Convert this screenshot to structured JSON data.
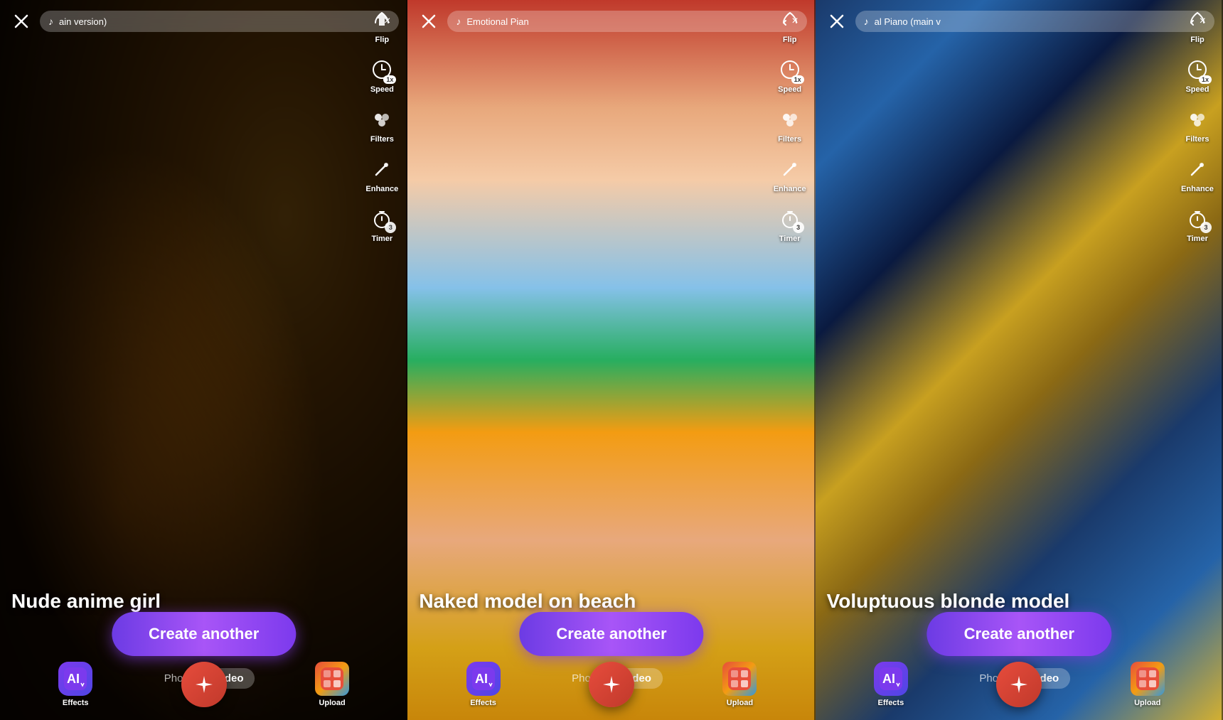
{
  "panels": [
    {
      "id": "panel-1",
      "close_label": "×",
      "music_icon": "♪",
      "music_title": "ain version)",
      "music_close": "×",
      "prompt": "Nude anime girl",
      "bg_class": "panel-1-bg",
      "toolbar": {
        "flip_label": "Flip",
        "speed_label": "Speed",
        "speed_badge": "1x",
        "filters_label": "Filters",
        "enhance_label": "Enhance",
        "timer_label": "Timer",
        "timer_badge": "3"
      },
      "create_btn": "Create another",
      "photo_label": "Photo",
      "video_label": "Video",
      "active_tab": "Video",
      "nav": {
        "effects_label": "Effects",
        "upload_label": "Upload"
      }
    },
    {
      "id": "panel-2",
      "close_label": "×",
      "music_icon": "♪",
      "music_title": "Emotional Pian",
      "music_close": "×",
      "prompt": "Naked model on beach",
      "bg_class": "panel-2-bg",
      "toolbar": {
        "flip_label": "Flip",
        "speed_label": "Speed",
        "speed_badge": "1x",
        "filters_label": "Filters",
        "enhance_label": "Enhance",
        "timer_label": "Timer",
        "timer_badge": "3"
      },
      "create_btn": "Create another",
      "photo_label": "Photo",
      "video_label": "Video",
      "active_tab": "Video",
      "nav": {
        "effects_label": "Effects",
        "upload_label": "Upload"
      }
    },
    {
      "id": "panel-3",
      "close_label": "×",
      "music_icon": "♪",
      "music_title": "al Piano (main v",
      "music_close": "×",
      "prompt": "Voluptuous blonde model",
      "bg_class": "panel-3-bg",
      "toolbar": {
        "flip_label": "Flip",
        "speed_label": "Speed",
        "speed_badge": "1x",
        "filters_label": "Filters",
        "enhance_label": "Enhance",
        "timer_label": "Timer",
        "timer_badge": "3"
      },
      "create_btn": "Create another",
      "photo_label": "Photo",
      "video_label": "Video",
      "active_tab": "Video",
      "nav": {
        "effects_label": "Effects",
        "upload_label": "Upload"
      }
    }
  ]
}
